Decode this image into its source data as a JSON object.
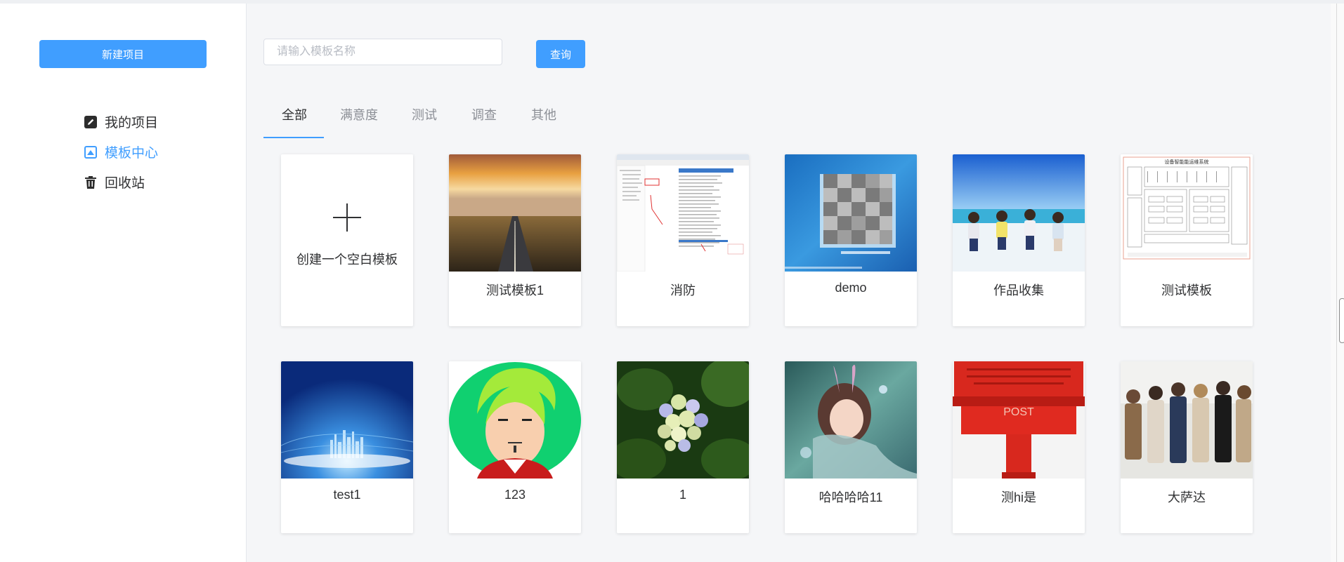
{
  "sidebar": {
    "new_project": "新建项目",
    "items": [
      {
        "label": "我的项目",
        "icon": "edit-icon"
      },
      {
        "label": "模板中心",
        "icon": "template-icon"
      },
      {
        "label": "回收站",
        "icon": "trash-icon"
      }
    ]
  },
  "search": {
    "placeholder": "请输入模板名称",
    "value": "",
    "button": "查询"
  },
  "tabs": [
    "全部",
    "满意度",
    "测试",
    "调查",
    "其他"
  ],
  "blank_template": {
    "label": "创建一个空白模板",
    "icon": "plus-icon"
  },
  "templates": [
    {
      "label": "测试模板1",
      "thumb": "road-sunset-image"
    },
    {
      "label": "消防",
      "thumb": "software-screenshot-image"
    },
    {
      "label": "demo",
      "thumb": "blurred-qr-image"
    },
    {
      "label": "作品收集",
      "thumb": "beach-people-image"
    },
    {
      "label": "测试模板",
      "thumb": "diagram-image",
      "thumb_text": "设备智能能运维系统"
    },
    {
      "label": "test1",
      "thumb": "city-tech-image"
    },
    {
      "label": "123",
      "thumb": "avatar-cartoon-image"
    },
    {
      "label": "1",
      "thumb": "hydrangea-image"
    },
    {
      "label": "哈哈哈哈11",
      "thumb": "anime-girl-image"
    },
    {
      "label": "测hi是",
      "thumb": "post-box-image",
      "thumb_text": "POST"
    },
    {
      "label": "大萨达",
      "thumb": "group-people-image"
    }
  ],
  "colors": {
    "accent": "#409eff",
    "background": "#f5f6f8"
  }
}
